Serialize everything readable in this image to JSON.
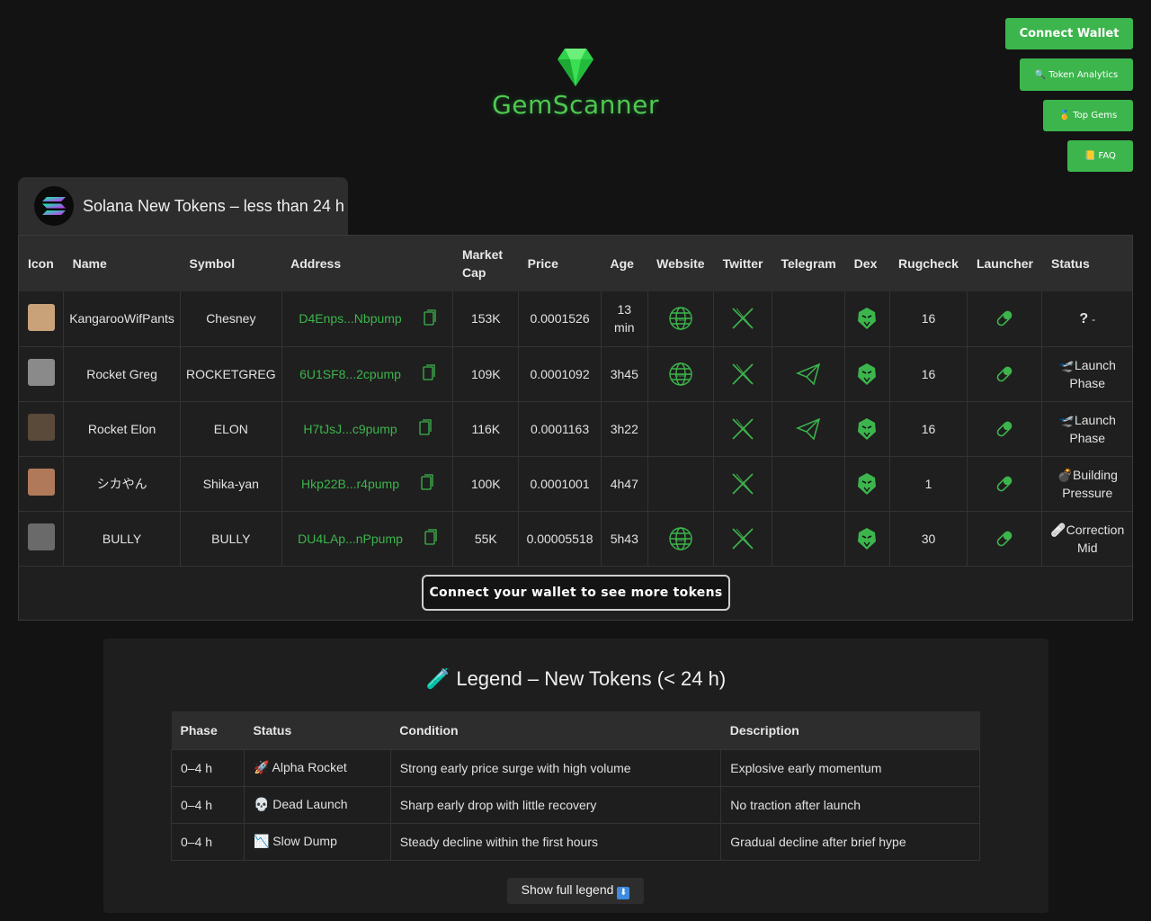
{
  "brand": {
    "name": "GemScanner"
  },
  "nav": {
    "connect_wallet": "Connect Wallet",
    "token_analytics": "Token Analytics",
    "top_gems": "Top Gems",
    "faq": "FAQ"
  },
  "tab": {
    "title": "Solana New Tokens – less than 24 h"
  },
  "tokens": {
    "headers": [
      "Icon",
      "Name",
      "Symbol",
      "Address",
      "Market Cap",
      "Price",
      "Age",
      "Website",
      "Twitter",
      "Telegram",
      "Dex",
      "Rugcheck",
      "Launcher",
      "Status"
    ],
    "rows": [
      {
        "name": "KangarooWifPants",
        "symbol": "Chesney",
        "address": "D4Enps...Nbpump",
        "market_cap": "153K",
        "price": "0.0001526",
        "age": "13 min",
        "website": true,
        "telegram": false,
        "rugcheck": "16",
        "status": "? -",
        "thumb": "#c9a27a"
      },
      {
        "name": "Rocket Greg",
        "symbol": "ROCKETGREG",
        "address": "6U1SF8...2cpump",
        "market_cap": "109K",
        "price": "0.0001092",
        "age": "3h45",
        "website": true,
        "telegram": true,
        "rugcheck": "16",
        "status": "Launch Phase",
        "thumb": "#8a8a8a"
      },
      {
        "name": "Rocket Elon",
        "symbol": "ELON",
        "address": "H7tJsJ...c9pump",
        "market_cap": "116K",
        "price": "0.0001163",
        "age": "3h22",
        "website": false,
        "telegram": true,
        "rugcheck": "16",
        "status": "Launch Phase",
        "thumb": "#5a4a3a"
      },
      {
        "name": "シカやん",
        "symbol": "Shika-yan",
        "address": "Hkp22B...r4pump",
        "market_cap": "100K",
        "price": "0.0001001",
        "age": "4h47",
        "website": false,
        "telegram": false,
        "rugcheck": "1",
        "status": "Building Pressure",
        "thumb": "#b07a5a"
      },
      {
        "name": "BULLY",
        "symbol": "BULLY",
        "address": "DU4LAp...nPpump",
        "market_cap": "55K",
        "price": "0.00005518",
        "age": "5h43",
        "website": true,
        "telegram": false,
        "rugcheck": "30",
        "status": "Correction Mid",
        "thumb": "#6a6a6a"
      }
    ],
    "more_label": "Connect your wallet to see more tokens"
  },
  "legend": {
    "title": "Legend – New Tokens (< 24 h)",
    "headers": [
      "Phase",
      "Status",
      "Condition",
      "Description"
    ],
    "rows": [
      {
        "phase": "0–4 h",
        "status": "Alpha Rocket",
        "icon": "🚀",
        "condition": "Strong early price surge with high volume",
        "description": "Explosive early momentum"
      },
      {
        "phase": "0–4 h",
        "status": "Dead Launch",
        "icon": "💀",
        "condition": "Sharp early drop with little recovery",
        "description": "No traction after launch"
      },
      {
        "phase": "0–4 h",
        "status": "Slow Dump",
        "icon": "📉",
        "condition": "Steady decline within the first hours",
        "description": "Gradual decline after brief hype"
      }
    ],
    "show_full": "Show full legend"
  }
}
